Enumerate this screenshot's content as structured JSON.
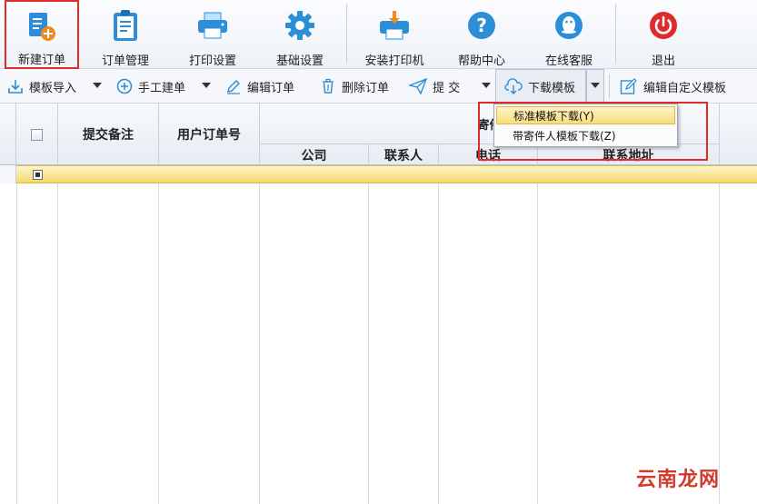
{
  "ribbon": {
    "buttons": [
      {
        "label": "新建订单",
        "icon": "new-order-icon"
      },
      {
        "label": "订单管理",
        "icon": "clipboard-icon"
      },
      {
        "label": "打印设置",
        "icon": "printer-icon"
      },
      {
        "label": "基础设置",
        "icon": "gear-icon"
      },
      {
        "label": "安装打印机",
        "icon": "printer-install-icon"
      },
      {
        "label": "帮助中心",
        "icon": "help-icon"
      },
      {
        "label": "在线客服",
        "icon": "qq-icon"
      },
      {
        "label": "退出",
        "icon": "power-icon"
      }
    ]
  },
  "toolbar": {
    "import_template": "模板导入",
    "manual_create": "手工建单",
    "edit_order": "编辑订单",
    "delete_order": "删除订单",
    "submit": "提  交",
    "download_template": "下载模板",
    "edit_custom_template": "编辑自定义模板"
  },
  "grid": {
    "columns": {
      "remark": "提交备注",
      "user_order_no": "用户订单号",
      "sender_group": "寄件",
      "company": "公司",
      "contact": "联系人",
      "phone": "电话",
      "address": "联系地址"
    }
  },
  "menu": {
    "items": [
      {
        "label": "标准模板下载(Y)"
      },
      {
        "label": "带寄件人模板下载(Z)"
      }
    ]
  },
  "watermark": {
    "text": "云南龙网"
  },
  "colors": {
    "accent_red": "#e02b2b",
    "brand_blue": "#2c8ed6",
    "highlight_yellow": "#f4d76c"
  }
}
